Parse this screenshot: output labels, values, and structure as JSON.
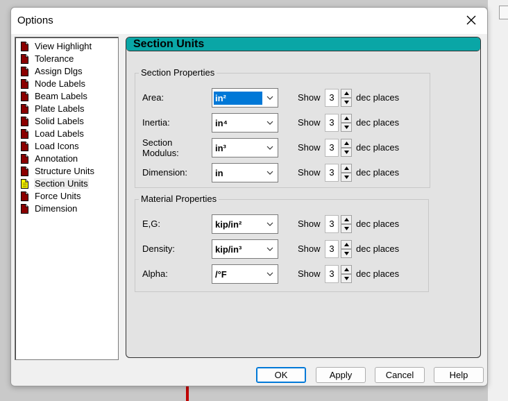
{
  "window": {
    "title": "Options"
  },
  "tree": {
    "items": [
      {
        "label": "View Highlight"
      },
      {
        "label": "Tolerance"
      },
      {
        "label": "Assign Dlgs"
      },
      {
        "label": "Node Labels"
      },
      {
        "label": "Beam Labels"
      },
      {
        "label": "Plate Labels"
      },
      {
        "label": "Solid Labels"
      },
      {
        "label": "Load Labels"
      },
      {
        "label": "Load Icons"
      },
      {
        "label": "Annotation"
      },
      {
        "label": "Structure Units"
      },
      {
        "label": "Section Units",
        "selected": true
      },
      {
        "label": "Force Units"
      },
      {
        "label": "Dimension"
      }
    ]
  },
  "panel": {
    "title": "Section Units",
    "section_properties": {
      "title": "Section Properties",
      "rows": [
        {
          "label": "Area:",
          "unit": "in²",
          "show": "Show",
          "decimals": "3",
          "suffix": "dec places"
        },
        {
          "label": "Inertia:",
          "unit": "in⁴",
          "show": "Show",
          "decimals": "3",
          "suffix": "dec places"
        },
        {
          "label": "Section\nModulus:",
          "unit": "in³",
          "show": "Show",
          "decimals": "3",
          "suffix": "dec places"
        },
        {
          "label": "Dimension:",
          "unit": "in",
          "show": "Show",
          "decimals": "3",
          "suffix": "dec places"
        }
      ]
    },
    "material_properties": {
      "title": "Material Properties",
      "rows": [
        {
          "label": "E,G:",
          "unit": "kip/in²",
          "show": "Show",
          "decimals": "3",
          "suffix": "dec places"
        },
        {
          "label": "Density:",
          "unit": "kip/in³",
          "show": "Show",
          "decimals": "3",
          "suffix": "dec places"
        },
        {
          "label": "Alpha:",
          "unit": "/°F",
          "show": "Show",
          "decimals": "3",
          "suffix": "dec places"
        }
      ]
    }
  },
  "buttons": {
    "ok": "OK",
    "apply": "Apply",
    "cancel": "Cancel",
    "help": "Help"
  },
  "colors": {
    "panel_header": "#0aa6a6",
    "selection": "#0078d7",
    "tree_icon": "#8b0000",
    "selected_icon": "#ffff00"
  },
  "icons": {
    "tree_item": "page-icon",
    "selected_tree_item": "highlighted-page-icon",
    "close": "close-icon"
  }
}
